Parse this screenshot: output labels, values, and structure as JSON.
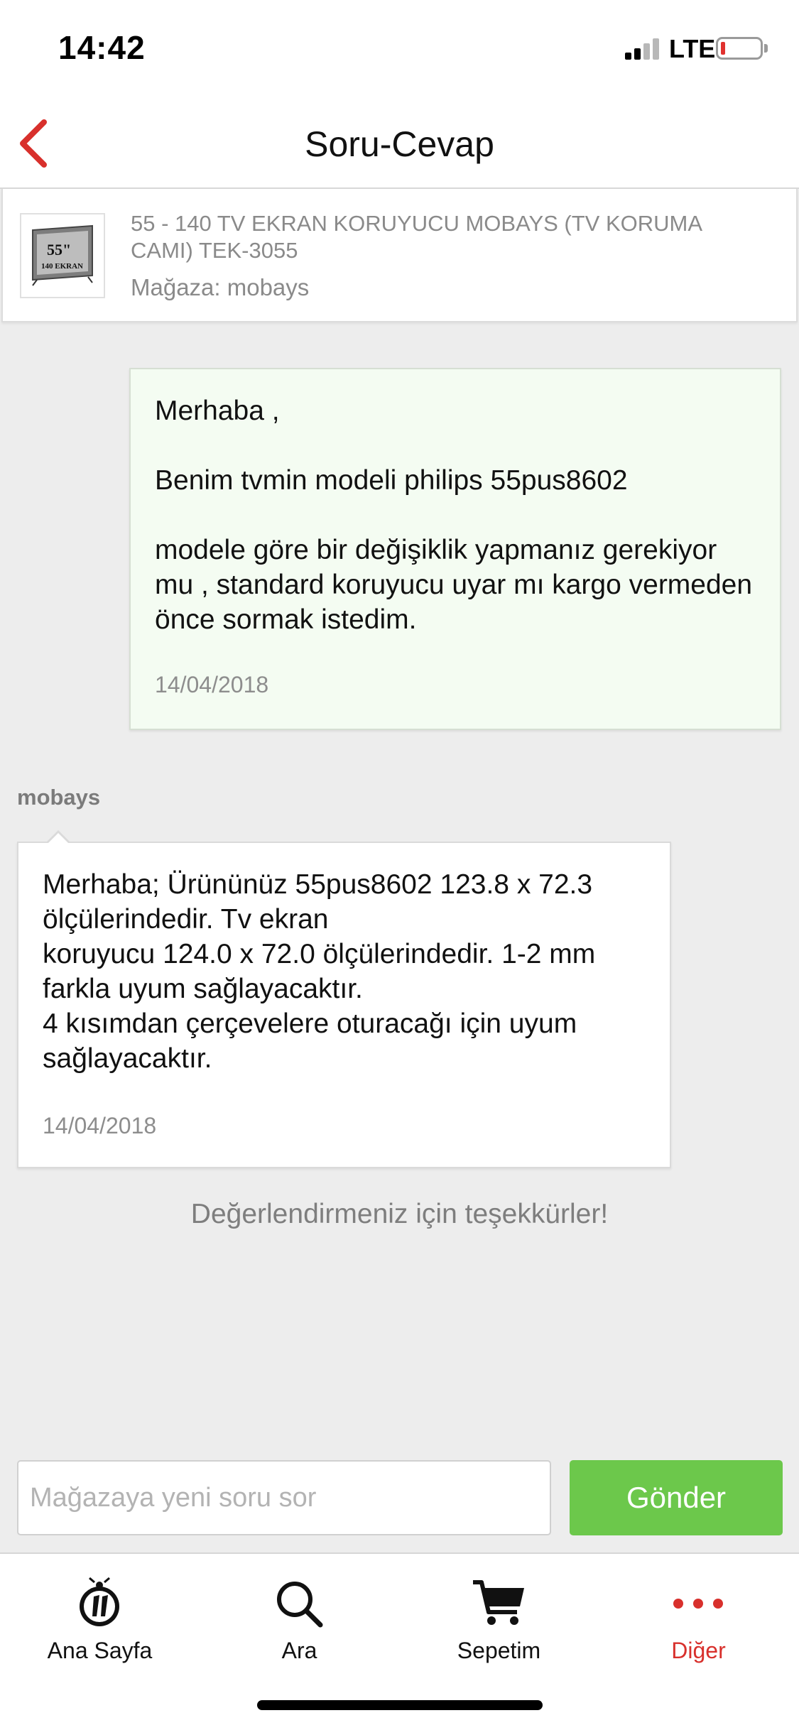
{
  "status_bar": {
    "time": "14:42",
    "network": "LTE",
    "battery_level": 0.1
  },
  "nav": {
    "title": "Soru-Cevap",
    "back_icon": "chevron-left-icon"
  },
  "product": {
    "thumbnail_text_top": "55\"",
    "thumbnail_text_bottom": "140 EKRAN",
    "name": "55 - 140 TV EKRAN KORUYUCU MOBAYS (TV KORUMA CAMI) TEK-3055",
    "store": "Mağaza: mobays"
  },
  "question": {
    "text": "Merhaba ,\n\nBenim tvmin modeli philips 55pus8602\n\nmodele göre bir değişiklik yapmanız gerekiyor mu , standard koruyucu uyar mı kargo vermeden önce sormak istedim.",
    "date": "14/04/2018"
  },
  "answer": {
    "author": "mobays",
    "text": "Merhaba; Ürününüz 55pus8602 123.8 x 72.3 ölçülerindedir. Tv ekran\nkoruyucu 124.0 x 72.0 ölçülerindedir. 1-2 mm farkla uyum sağlayacaktır.\n4 kısımdan çerçevelere oturacağı için uyum sağlayacaktır.",
    "date": "14/04/2018"
  },
  "thanks_message": "Değerlendirmeniz için teşekkürler!",
  "ask": {
    "placeholder": "Mağazaya yeni soru sor",
    "value": "",
    "send_label": "Gönder"
  },
  "tabs": [
    {
      "label": "Ana Sayfa",
      "icon": "home-ladybug-icon",
      "active": false
    },
    {
      "label": "Ara",
      "icon": "search-icon",
      "active": false
    },
    {
      "label": "Sepetim",
      "icon": "cart-icon",
      "active": false
    },
    {
      "label": "Diğer",
      "icon": "more-dots-icon",
      "active": true
    }
  ],
  "colors": {
    "accent_red": "#d8302c",
    "send_green": "#6cc84b",
    "question_bg": "#f4fcf2"
  }
}
